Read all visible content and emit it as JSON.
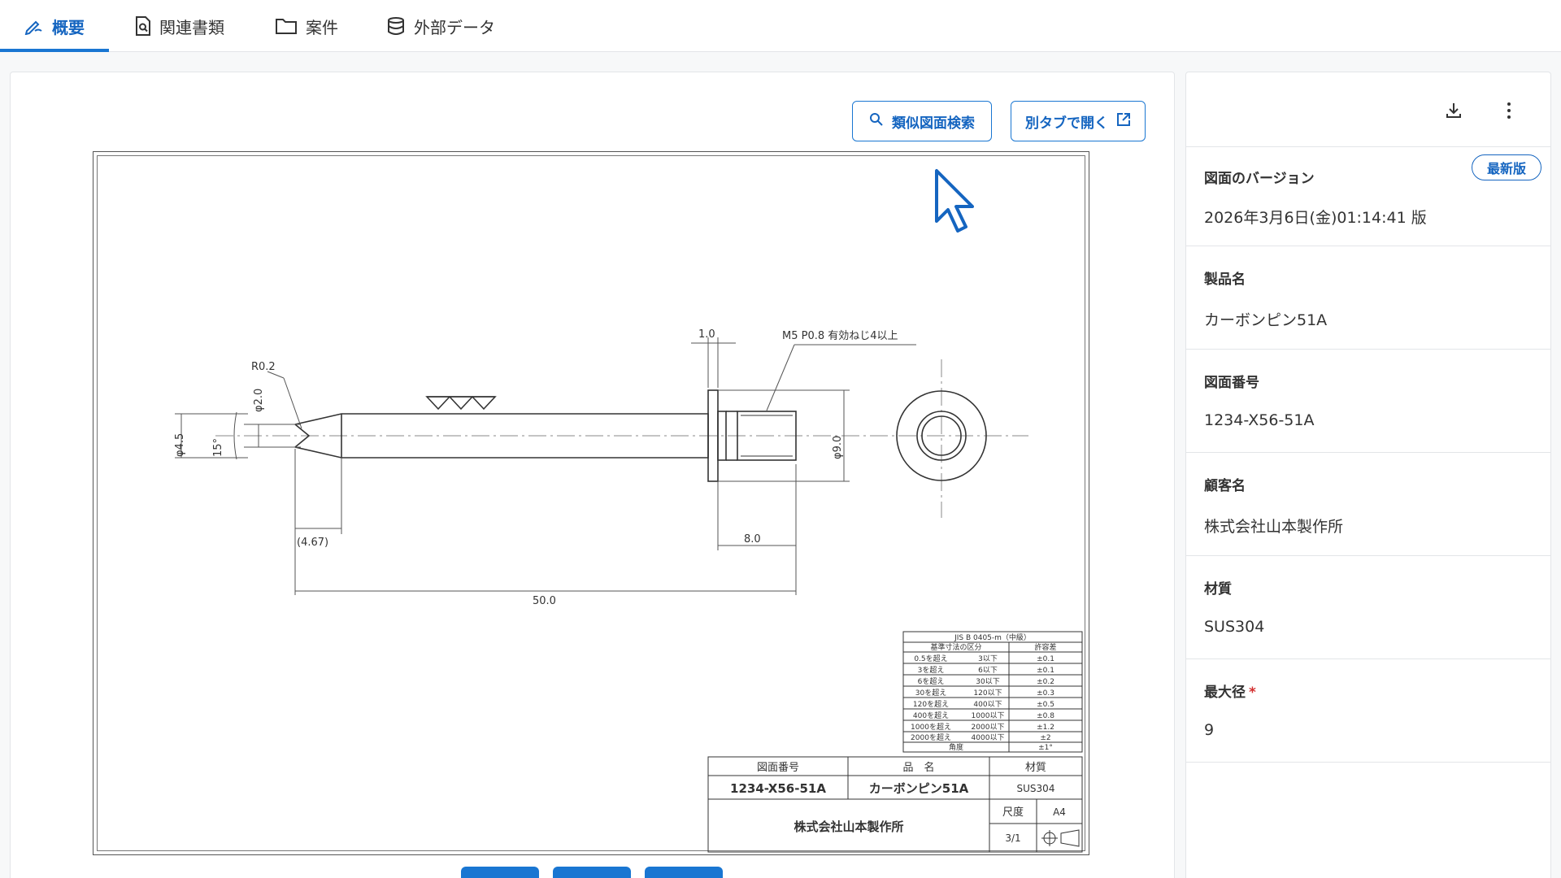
{
  "tabs": [
    {
      "label": "概要",
      "icon": "pen-icon",
      "active": true
    },
    {
      "label": "関連書類",
      "icon": "document-search-icon",
      "active": false
    },
    {
      "label": "案件",
      "icon": "folder-icon",
      "active": false
    },
    {
      "label": "外部データ",
      "icon": "database-icon",
      "active": false
    }
  ],
  "actions": {
    "similar_search": "類似図面検索",
    "open_new_tab": "別タブで開く"
  },
  "drawing": {
    "dims": {
      "r02": "R0.2",
      "d20": "φ2.0",
      "d45": "φ4.5",
      "angle15": "15°",
      "d467": "(4.67)",
      "len50": "50.0",
      "len10": "1.0",
      "len80": "8.0",
      "d90": "φ9.0",
      "thread": "M5 P0.8 有効ねじ4以上"
    },
    "tolerance": {
      "title": "JIS B 0405-m（中級）",
      "head_range": "基準寸法の区分",
      "head_tol": "許容差",
      "rows": [
        {
          "from": "0.5を超え",
          "to": "3以下",
          "tol": "±0.1"
        },
        {
          "from": "3を超え",
          "to": "6以下",
          "tol": "±0.1"
        },
        {
          "from": "6を超え",
          "to": "30以下",
          "tol": "±0.2"
        },
        {
          "from": "30を超え",
          "to": "120以下",
          "tol": "±0.3"
        },
        {
          "from": "120を超え",
          "to": "400以下",
          "tol": "±0.5"
        },
        {
          "from": "400を超え",
          "to": "1000以下",
          "tol": "±0.8"
        },
        {
          "from": "1000を超え",
          "to": "2000以下",
          "tol": "±1.2"
        },
        {
          "from": "2000を超え",
          "to": "4000以下",
          "tol": "±2"
        },
        {
          "from": "角度",
          "to": "",
          "tol": "±1°"
        }
      ]
    },
    "title_block": {
      "h_number": "図面番号",
      "h_name": "品　名",
      "h_material": "材質",
      "number": "1234-X56-51A",
      "name": "カーボンピン51A",
      "material": "SUS304",
      "company": "株式会社山本製作所",
      "scale_label": "尺度",
      "paper": "A4",
      "scale": "3/1"
    }
  },
  "side": {
    "version_label": "図面のバージョン",
    "version_badge": "最新版",
    "version_value": "2026年3月6日(金)01:14:41 版",
    "fields": [
      {
        "label": "製品名",
        "value": "カーボンピン51A",
        "required": false
      },
      {
        "label": "図面番号",
        "value": "1234-X56-51A",
        "required": false
      },
      {
        "label": "顧客名",
        "value": "株式会社山本製作所",
        "required": false
      },
      {
        "label": "材質",
        "value": "SUS304",
        "required": false
      },
      {
        "label": "最大径",
        "value": "9",
        "required": true,
        "required_mark": "*"
      }
    ]
  },
  "colors": {
    "accent": "#1976d2",
    "accent_dark": "#1565c0",
    "required": "#d32f2f"
  }
}
